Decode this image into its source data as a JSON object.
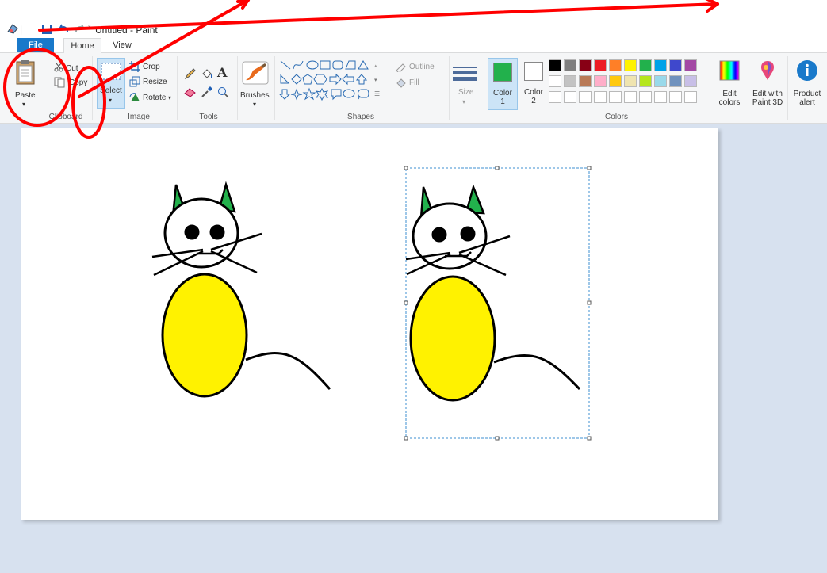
{
  "window": {
    "title": "Untitled - Paint"
  },
  "tabs": [
    "File",
    "Home",
    "View"
  ],
  "clipboard": {
    "paste": "Paste",
    "cut": "Cut",
    "copy": "Copy",
    "group": "Clipboard"
  },
  "image": {
    "select": "Select",
    "crop": "Crop",
    "resize": "Resize",
    "rotate": "Rotate",
    "group": "Image"
  },
  "tools": {
    "group": "Tools"
  },
  "brushes": {
    "label": "Brushes"
  },
  "shapes": {
    "outline": "Outline",
    "fill": "Fill",
    "group": "Shapes"
  },
  "size": {
    "label": "Size"
  },
  "colors": {
    "color1": "Color 1",
    "color2": "Color 2",
    "edit": "Edit colors",
    "group": "Colors",
    "color1_value": "#22b14c",
    "color2_value": "#ffffff",
    "palette_row1": [
      "#000000",
      "#7f7f7f",
      "#880015",
      "#ed1c24",
      "#ff7f27",
      "#fff200",
      "#22b14c",
      "#00a2e8",
      "#3f48cc",
      "#a349a4"
    ],
    "palette_row2": [
      "#ffffff",
      "#c3c3c3",
      "#b97a57",
      "#ffaec9",
      "#ffc90e",
      "#efe4b0",
      "#b5e61d",
      "#99d9ea",
      "#7092be",
      "#c8bfe7"
    ]
  },
  "paint3d": {
    "label": "Edit with Paint 3D"
  },
  "product_alert": {
    "label": "Product alert"
  },
  "drawing": {
    "body_color": "#fff200",
    "ear_color": "#22b14c"
  },
  "annotation": {
    "color": "#ff0000"
  }
}
